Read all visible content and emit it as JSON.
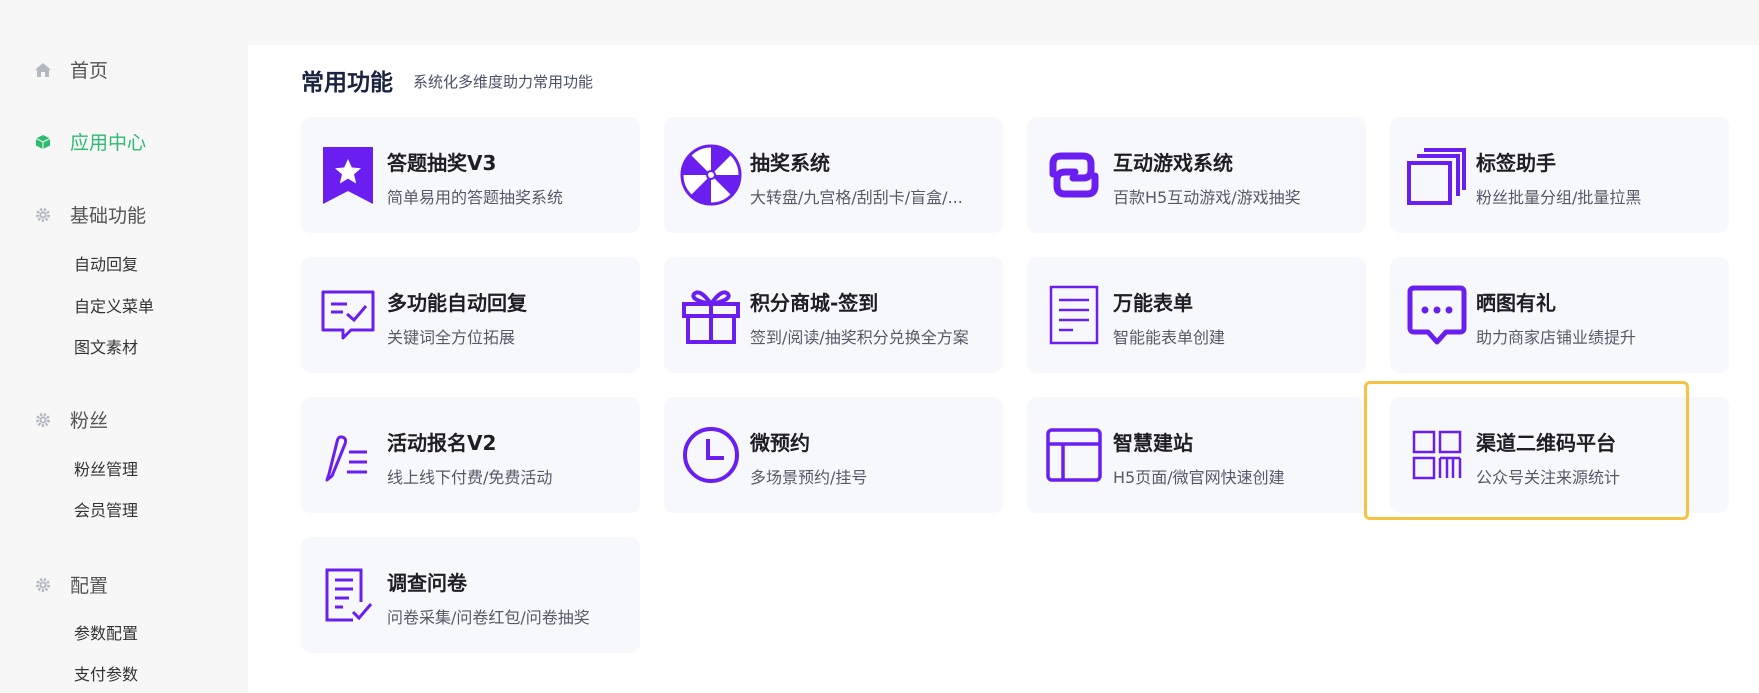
{
  "sidebar": {
    "home": "首页",
    "app_center": "应用中心",
    "basic": {
      "label": "基础功能",
      "items": [
        "自动回复",
        "自定义菜单",
        "图文素材"
      ]
    },
    "fans": {
      "label": "粉丝",
      "items": [
        "粉丝管理",
        "会员管理"
      ]
    },
    "config": {
      "label": "配置",
      "items": [
        "参数配置",
        "支付参数"
      ]
    }
  },
  "section": {
    "title": "常用功能",
    "subtitle": "系统化多维度助力常用功能"
  },
  "cards": [
    {
      "title": "答题抽奖V3",
      "desc": "简单易用的答题抽奖系统",
      "icon": "bookmark-star-icon"
    },
    {
      "title": "抽奖系统",
      "desc": "大转盘/九宫格/刮刮卡/盲盒/...",
      "icon": "prize-wheel-icon"
    },
    {
      "title": "互动游戏系统",
      "desc": "百款H5互动游戏/游戏抽奖",
      "icon": "link-loop-icon"
    },
    {
      "title": "标签助手",
      "desc": "粉丝批量分组/批量拉黑",
      "icon": "stacked-squares-icon"
    },
    {
      "title": "多功能自动回复",
      "desc": "关键词全方位拓展",
      "icon": "message-check-icon"
    },
    {
      "title": "积分商城-签到",
      "desc": "签到/阅读/抽奖积分兑换全方案",
      "icon": "gift-icon"
    },
    {
      "title": "万能表单",
      "desc": "智能能表单创建",
      "icon": "document-lines-icon"
    },
    {
      "title": "晒图有礼",
      "desc": "助力商家店铺业绩提升",
      "icon": "chat-bubble-dots-icon"
    },
    {
      "title": "活动报名V2",
      "desc": "线上线下付费/免费活动",
      "icon": "pen-list-icon"
    },
    {
      "title": "微预约",
      "desc": "多场景预约/挂号",
      "icon": "clock-icon"
    },
    {
      "title": "智慧建站",
      "desc": "H5页面/微官网快速创建",
      "icon": "layout-icon"
    },
    {
      "title": "渠道二维码平台",
      "desc": "公众号关注来源统计",
      "icon": "qr-grid-icon"
    },
    {
      "title": "调查问卷",
      "desc": "问卷采集/问卷红包/问卷抽奖",
      "icon": "checklist-icon"
    }
  ],
  "colors": {
    "accent": "#6a1ff0",
    "active_nav": "#2dbb6e",
    "highlight_border": "#f6c244"
  }
}
